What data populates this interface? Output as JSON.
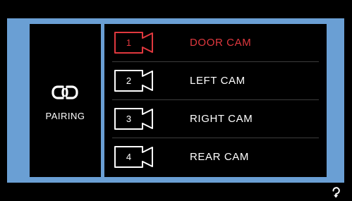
{
  "pairing": {
    "icon": "link-icon",
    "label": "PAIRING"
  },
  "cameras": [
    {
      "number": "1",
      "label": "DOOR CAM",
      "active": true
    },
    {
      "number": "2",
      "label": "LEFT CAM",
      "active": false
    },
    {
      "number": "3",
      "label": "RIGHT CAM",
      "active": false
    },
    {
      "number": "4",
      "label": "REAR CAM",
      "active": false
    }
  ],
  "footer": {
    "icon": "refresh-icon"
  },
  "colors": {
    "frame": "#6a9fd4",
    "active": "#e0383e",
    "text": "#ffffff",
    "background": "#000000"
  }
}
